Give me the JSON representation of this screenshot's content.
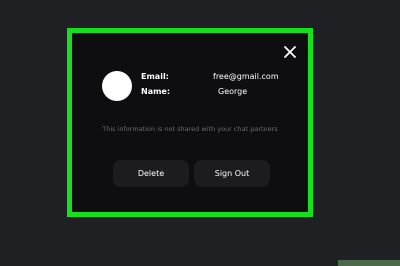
{
  "modal": {
    "email_label": "Email:",
    "email_value": "free@gmail.com",
    "name_label": "Name:",
    "name_value": "George",
    "notice": "This information is not shared with your chat partners",
    "delete_label": "Delete",
    "signout_label": "Sign Out"
  },
  "icons": {
    "close": "close-icon",
    "avatar": "avatar"
  },
  "colors": {
    "page_background": "#1f2023",
    "modal_background": "#0e0e10",
    "highlight_border": "#16e01b",
    "button_background": "#1c1c1f",
    "notice_text": "#6a6a6e"
  }
}
